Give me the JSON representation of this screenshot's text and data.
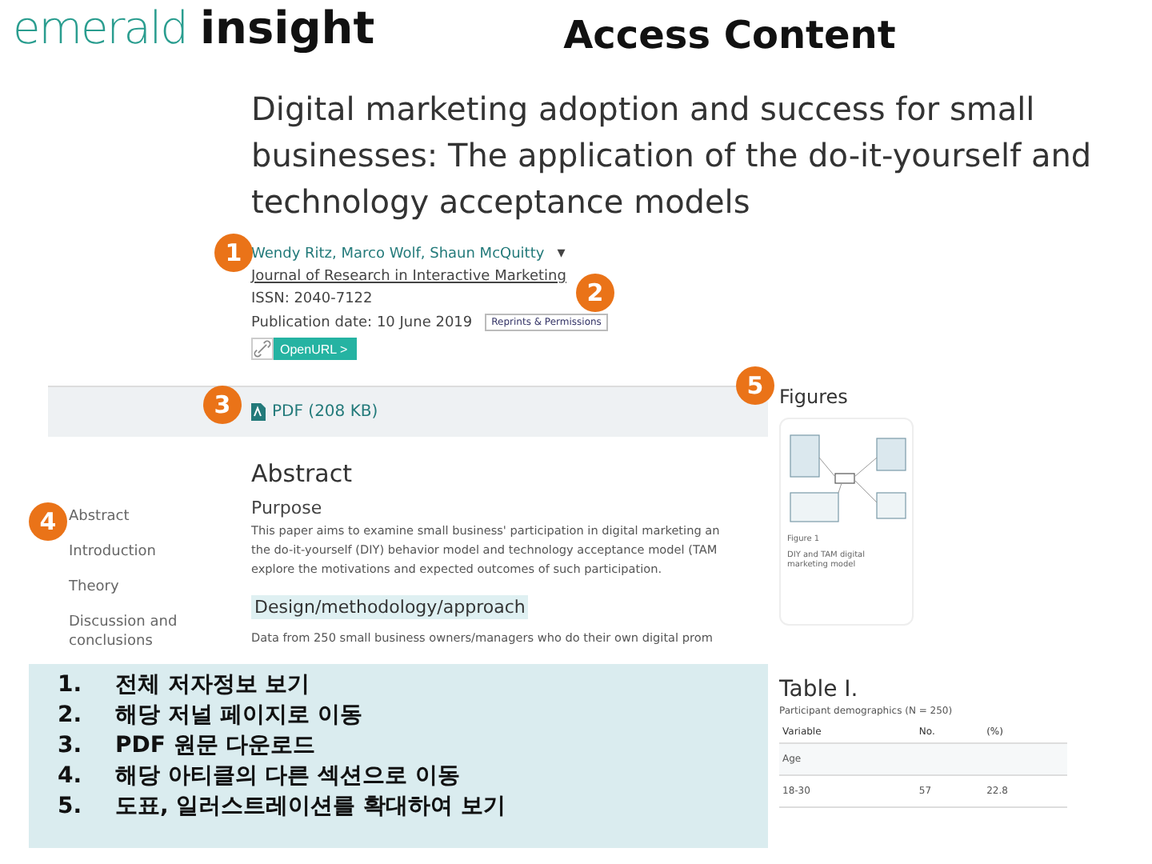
{
  "logo": {
    "light": "emerald",
    "bold": "insight"
  },
  "slide_title": "Access Content",
  "article": {
    "title": "Digital marketing adoption and success for small businesses: The application of the do-it-yourself and technology acceptance models",
    "authors": "Wendy Ritz, Marco Wolf, Shaun McQuitty",
    "caret": "▾",
    "journal": "Journal of Research in Interactive Marketing",
    "issn": "ISSN: 2040-7122",
    "publication_date": "Publication date: 10 June 2019",
    "permissions": "Reprints & Permissions",
    "openurl": "OpenURL",
    "openurl_caret": ">",
    "pdf": "PDF (208 KB)"
  },
  "nav": [
    {
      "label": "Abstract"
    },
    {
      "label": "Introduction"
    },
    {
      "label": "Theory"
    },
    {
      "label": "Discussion and conclusions"
    }
  ],
  "abstract": {
    "heading": "Abstract",
    "purpose_heading": "Purpose",
    "purpose_lines": [
      "This paper aims to examine small business' participation in digital marketing an",
      "the do-it-yourself (DIY) behavior model and technology acceptance model (TAM",
      "explore the motivations and expected outcomes of such participation."
    ],
    "design_heading": "Design/methodology/approach",
    "design_line": "Data from 250 small business owners/managers who do their own digital prom"
  },
  "figures": {
    "heading": "Figures",
    "figure_label": "Figure 1",
    "figure_caption": "DIY and TAM digital marketing model"
  },
  "table": {
    "heading": "Table I.",
    "caption": "Participant demographics (N = 250)",
    "columns": [
      "Variable",
      "No.",
      "(%)"
    ],
    "rows": [
      [
        "Age",
        "",
        ""
      ],
      [
        "18-30",
        "57",
        "22.8"
      ]
    ]
  },
  "callouts": [
    {
      "number": "1"
    },
    {
      "number": "2"
    },
    {
      "number": "3"
    },
    {
      "number": "4"
    },
    {
      "number": "5"
    }
  ],
  "notes": [
    {
      "number": "1.",
      "text": "전체 저자정보 보기"
    },
    {
      "number": "2.",
      "text": "해당 저널 페이지로 이동"
    },
    {
      "number": "3.",
      "text": "PDF 원문 다운로드"
    },
    {
      "number": "4.",
      "text": "해당 아티클의 다른 섹션으로 이동"
    },
    {
      "number": "5.",
      "text": "도표, 일러스트레이션를 확대하여 보기"
    }
  ]
}
